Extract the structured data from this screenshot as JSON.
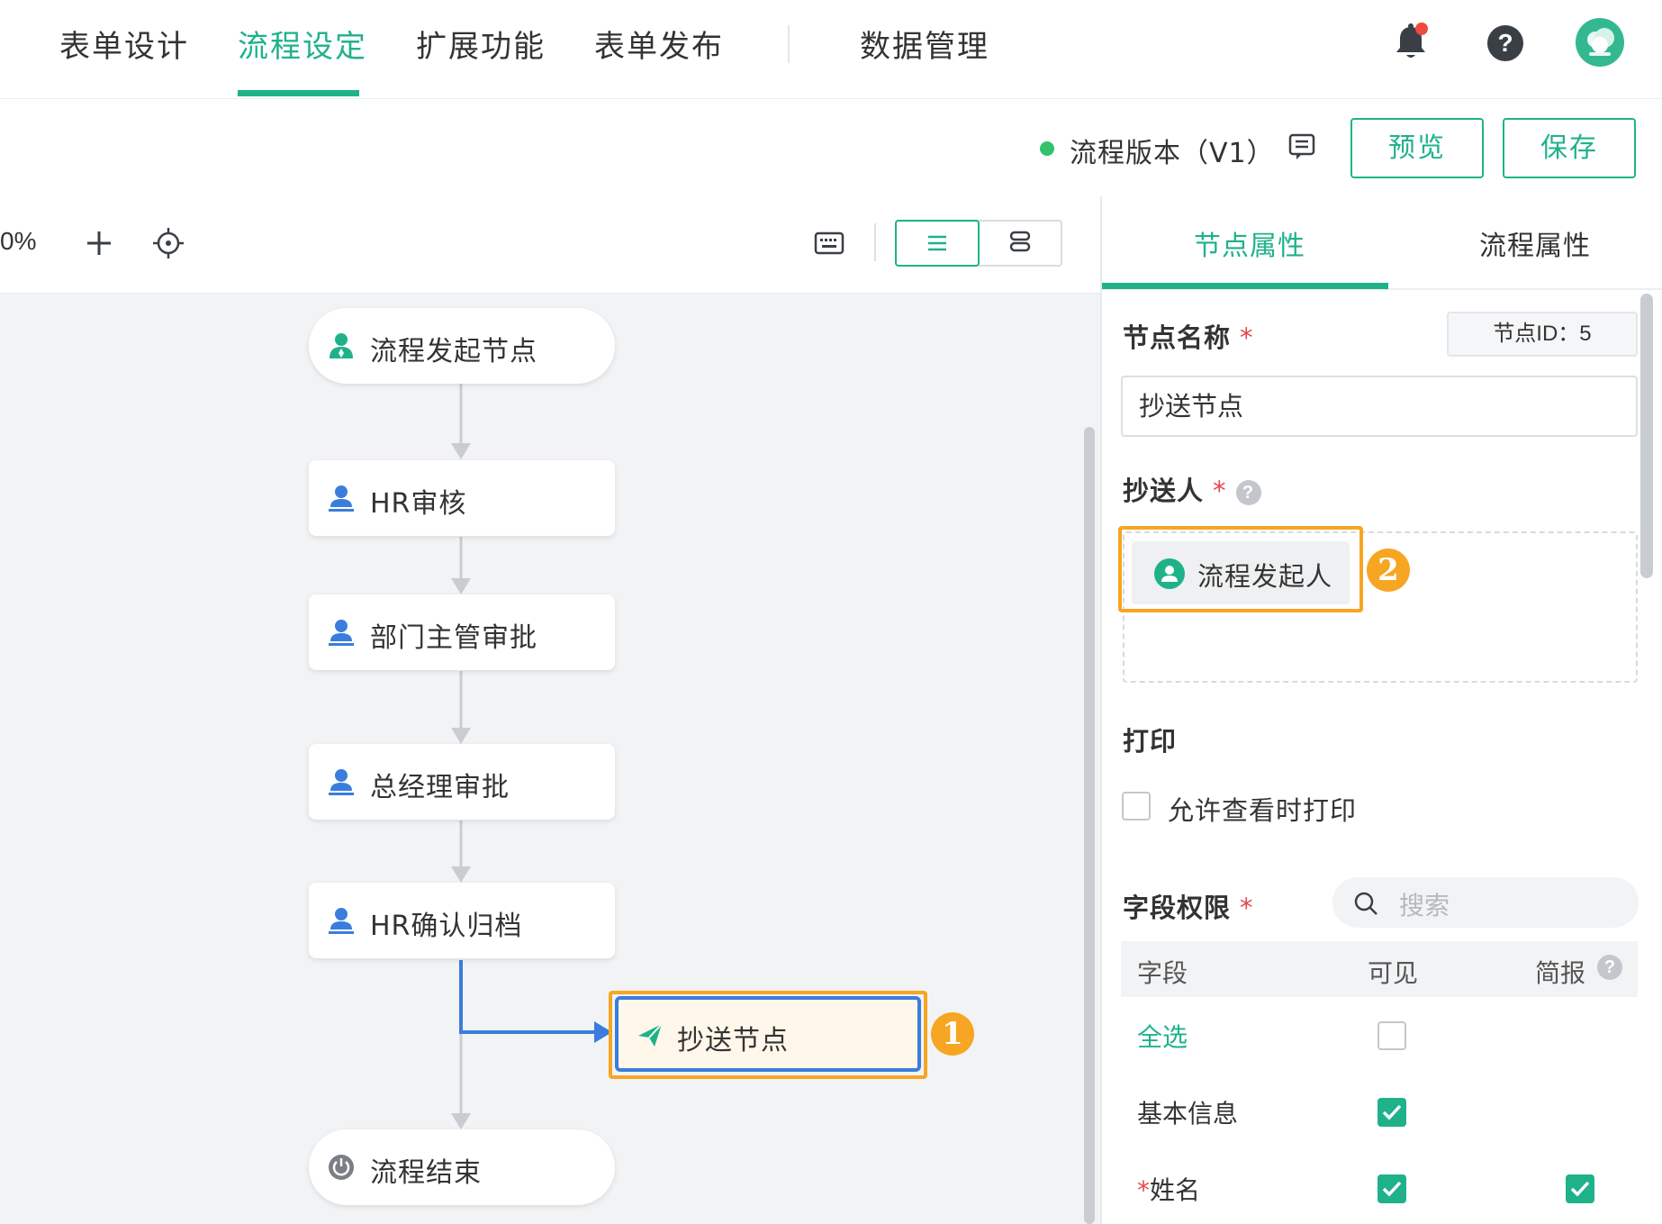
{
  "topnav": {
    "tabs": [
      "表单设计",
      "流程设定",
      "扩展功能",
      "表单发布",
      "数据管理"
    ],
    "active_tab": "流程设定"
  },
  "subbar": {
    "version_label": "流程版本（V1）",
    "preview_label": "预览",
    "save_label": "保存"
  },
  "toolbar": {
    "zoom_text": "0%"
  },
  "flow": {
    "nodes": [
      {
        "label": "流程发起节点",
        "icon": "initiator-icon"
      },
      {
        "label": "HR审核",
        "icon": "approver-icon"
      },
      {
        "label": "部门主管审批",
        "icon": "approver-icon"
      },
      {
        "label": "总经理审批",
        "icon": "approver-icon"
      },
      {
        "label": "HR确认归档",
        "icon": "approver-icon"
      },
      {
        "label": "流程结束",
        "icon": "power-icon"
      }
    ],
    "cc_node": {
      "label": "抄送节点",
      "icon": "send-icon"
    },
    "badge_1": "1",
    "badge_2": "2"
  },
  "panel": {
    "tabs": [
      "节点属性",
      "流程属性"
    ],
    "active_tab": "节点属性",
    "node_name_title": "节点名称",
    "node_id_label": "节点ID：5",
    "node_name_value": "抄送节点",
    "cc_title": "抄送人",
    "cc_chip": "流程发起人",
    "print_title": "打印",
    "print_option": "允许查看时打印",
    "print_checked": false,
    "field_perm_title": "字段权限",
    "search_placeholder": "搜索",
    "required_mark": "*",
    "table": {
      "headers": [
        "字段",
        "可见",
        "简报"
      ],
      "rows": [
        {
          "field": "全选",
          "visible": false,
          "brief": null
        },
        {
          "field": "基本信息",
          "visible": true,
          "brief": null
        },
        {
          "field": "*姓名",
          "visible": true,
          "brief": true
        }
      ]
    }
  },
  "colors": {
    "accent": "#1fb28a",
    "highlight": "#f6a623",
    "selected_border": "#3b7ddd",
    "notification_dot": "#f0493e",
    "status_dot": "#31c26b"
  }
}
